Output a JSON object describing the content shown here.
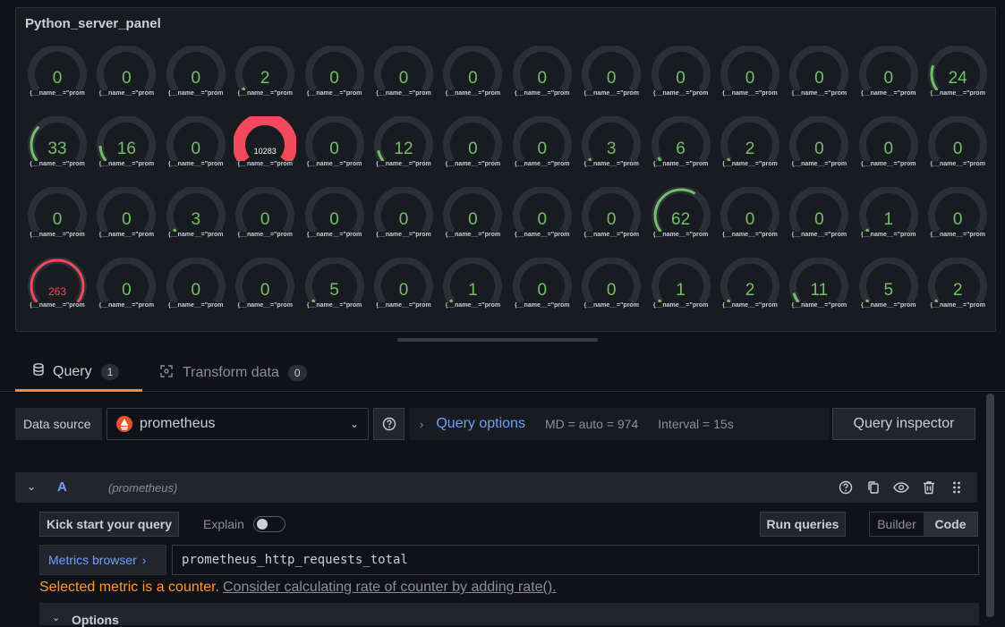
{
  "panel": {
    "title": "Python_server_panel",
    "gauge_label": "{__name__=\"prom",
    "gauges": [
      [
        "0",
        "0",
        "0",
        "2",
        "0",
        "0",
        "0",
        "0",
        "0",
        "0",
        "0",
        "0",
        "0",
        "24"
      ],
      [
        "33",
        "16",
        "0",
        "10283",
        "0",
        "12",
        "0",
        "0",
        "3",
        "6",
        "2",
        "0",
        "0",
        "0"
      ],
      [
        "0",
        "0",
        "3",
        "0",
        "0",
        "0",
        "0",
        "0",
        "0",
        "62",
        "0",
        "0",
        "1",
        "0"
      ],
      [
        "263",
        "0",
        "0",
        "0",
        "5",
        "0",
        "1",
        "0",
        "0",
        "1",
        "2",
        "11",
        "5",
        "2"
      ]
    ],
    "colors": {
      "threshold_red": "#f2495c",
      "value_green": "#73bf69",
      "track": "#2c2f36"
    }
  },
  "tabs": [
    {
      "label": "Query",
      "count": "1",
      "active": true
    },
    {
      "label": "Transform data",
      "count": "0",
      "active": false
    }
  ],
  "datasource": {
    "label": "Data source",
    "value": "prometheus",
    "query_options_label": "Query options",
    "md": "MD = auto = 974",
    "interval": "Interval = 15s",
    "inspector_label": "Query inspector"
  },
  "query": {
    "ref_id": "A",
    "datasource": "(prometheus)",
    "kick_start": "Kick start your query",
    "explain": "Explain",
    "run": "Run queries",
    "builder": "Builder",
    "code": "Code",
    "metrics_browser": "Metrics browser",
    "expression": "prometheus_http_requests_total",
    "warning": "Selected metric is a counter.",
    "warning_link": "Consider calculating rate of counter by adding rate().",
    "options_label": "Options"
  }
}
